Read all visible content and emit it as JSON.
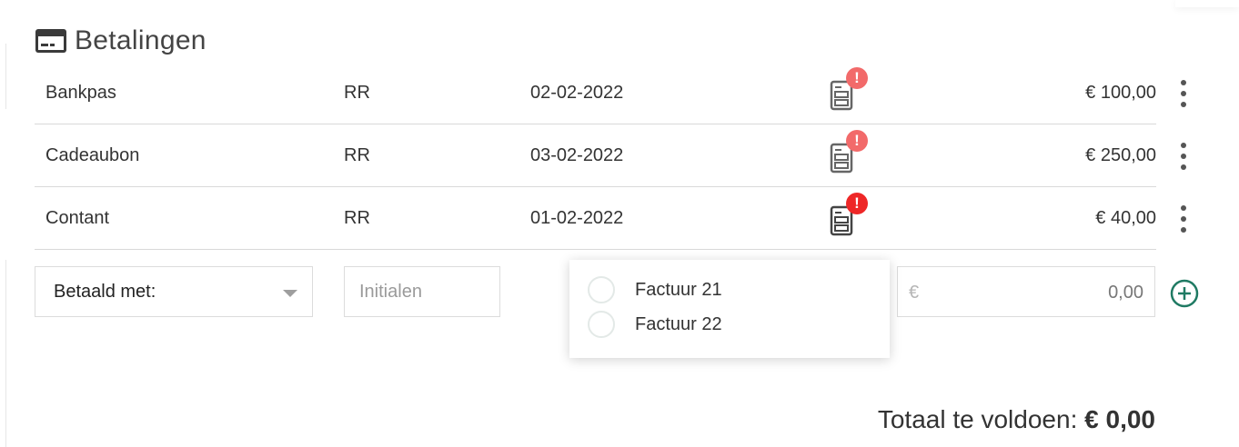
{
  "section": {
    "title": "Betalingen",
    "icon": "credit-card-icon"
  },
  "payments": [
    {
      "method": "Bankpas",
      "initials": "RR",
      "date": "02-02-2022",
      "amount": "€ 100,00",
      "receipt_icon": "receipt-icon",
      "alert_color": "#f26a6a"
    },
    {
      "method": "Cadeaubon",
      "initials": "RR",
      "date": "03-02-2022",
      "amount": "€ 250,00",
      "receipt_icon": "receipt-icon",
      "alert_color": "#f26a6a"
    },
    {
      "method": "Contant",
      "initials": "RR",
      "date": "01-02-2022",
      "amount": "€ 40,00",
      "receipt_icon": "receipt-icon",
      "alert_color": "#ee2727"
    }
  ],
  "form": {
    "payment_method_label": "Betaald met:",
    "initials_placeholder": "Initialen",
    "currency_symbol": "€",
    "amount_value": "0,00",
    "add_icon": "plus-circle-icon"
  },
  "invoices": [
    {
      "label": "Factuur 21",
      "selected": false
    },
    {
      "label": "Factuur 22",
      "selected": false
    }
  ],
  "total": {
    "label": "Totaal te voldoen:",
    "value": "€ 0,00"
  },
  "colors": {
    "accent": "#1f7a63",
    "alert": "#f26a6a",
    "alert_strong": "#ee2727",
    "icon": "#555555"
  }
}
